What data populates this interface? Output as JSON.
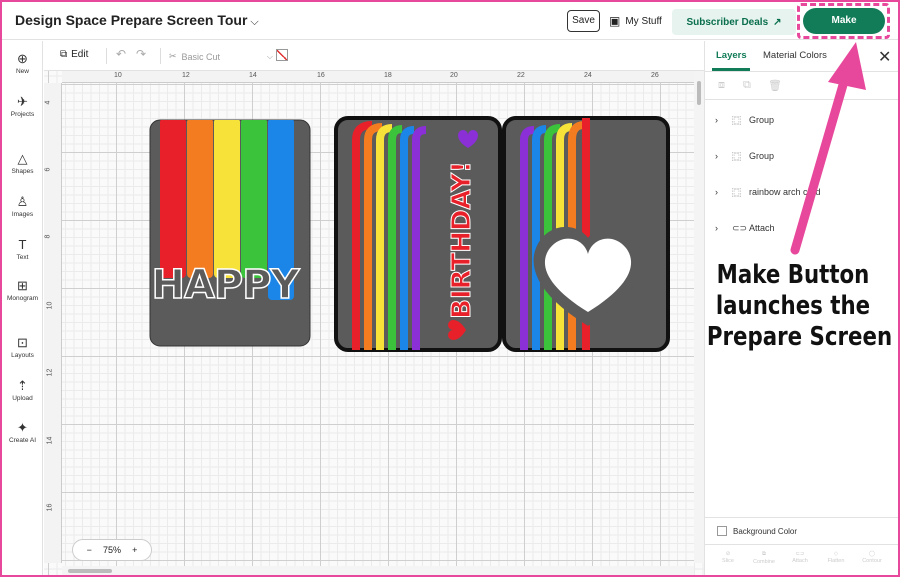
{
  "header": {
    "project_title": "Design Space Prepare Screen Tour",
    "save_label": "Save",
    "mystuff_label": "My Stuff",
    "subscriber_label": "Subscriber Deals",
    "make_label": "Make"
  },
  "nav": [
    {
      "label": "New",
      "icon": "plus-icon"
    },
    {
      "label": "Projects",
      "icon": "projects-icon"
    },
    {
      "label": "Shapes",
      "icon": "shapes-icon"
    },
    {
      "label": "Images",
      "icon": "images-icon"
    },
    {
      "label": "Text",
      "icon": "text-icon"
    },
    {
      "label": "Monogram",
      "icon": "monogram-icon"
    },
    {
      "label": "Layouts",
      "icon": "layouts-icon"
    },
    {
      "label": "Upload",
      "icon": "upload-icon"
    },
    {
      "label": "Create AI",
      "icon": "sparkle-icon"
    }
  ],
  "toolbar": {
    "edit_label": "Edit",
    "operation_value": "Basic Cut"
  },
  "rulers": {
    "top": [
      "10",
      "12",
      "14",
      "16",
      "18",
      "20",
      "22",
      "24",
      "26"
    ],
    "left": [
      "4",
      "6",
      "8",
      "10",
      "12",
      "14",
      "16"
    ]
  },
  "zoom": {
    "value": "75%",
    "minus": "−",
    "plus": "+"
  },
  "design": {
    "happy_text": "HAPPY",
    "birthday_text": "BIRTHDAY!"
  },
  "panel": {
    "tab_layers": "Layers",
    "tab_materials": "Material Colors",
    "layers": [
      {
        "name": "Group",
        "icon": "group-icon"
      },
      {
        "name": "Group",
        "icon": "group-icon"
      },
      {
        "name": "rainbow arch card",
        "icon": "group-icon"
      },
      {
        "name": "Attach",
        "icon": "attach-icon"
      }
    ],
    "background_color_label": "Background Color",
    "actions": [
      "Slice",
      "Combine",
      "Attach",
      "Flatten",
      "Contour"
    ]
  },
  "annotation": {
    "lines": [
      "Make Button",
      "launches the",
      "Prepare Screen"
    ],
    "color": "#e8489c"
  },
  "colors": {
    "brand_green": "#127c58",
    "rainbow": [
      "#e8202a",
      "#f47c20",
      "#f7e23a",
      "#3bc43b",
      "#1b86e8",
      "#8b2fd6"
    ]
  }
}
